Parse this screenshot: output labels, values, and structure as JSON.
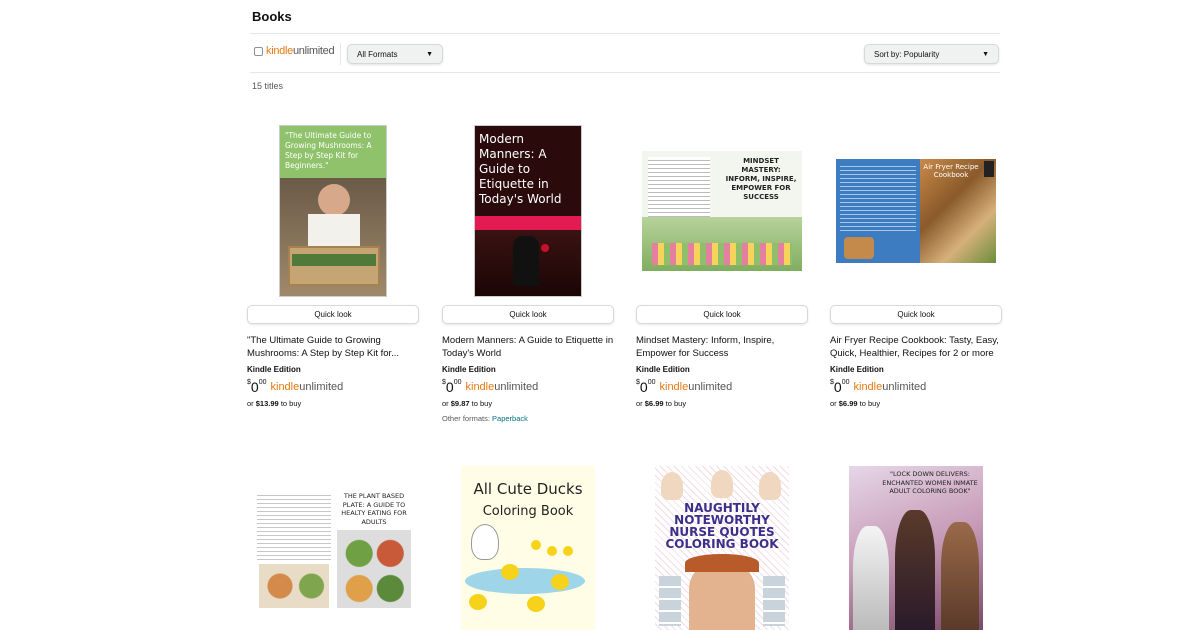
{
  "header": {
    "title": "Books"
  },
  "filters": {
    "ku_kindle": "kindle",
    "ku_unlimited": "unlimited",
    "formats_label": "All Formats",
    "sort_label": "Sort by: Popularity"
  },
  "results": {
    "count_label": "15 titles"
  },
  "common": {
    "quick_look": "Quick look",
    "edition": "Kindle Edition",
    "price_symbol": "$",
    "price_whole": "0",
    "price_fraction": "00",
    "ku_kindle": "kindle",
    "ku_unlimited": "unlimited",
    "to_buy": "to buy",
    "or": "or"
  },
  "books": [
    {
      "title": "\"The Ultimate Guide to Growing Mushrooms: A Step by Step Kit for...",
      "buy_price": "$13.99",
      "cover_text": "\"The Ultimate Guide to Growing Mushrooms: A Step by Step Kit for Beginners.\""
    },
    {
      "title": "Modern Manners: A Guide to Etiquette in Today's World",
      "buy_price": "$9.87",
      "cover_text": "Modern Manners: A Guide to Etiquette in Today's World",
      "other_formats_label": "Other formats:",
      "other_formats_link": "Paperback"
    },
    {
      "title": "Mindset Mastery: Inform, Inspire, Empower for Success",
      "buy_price": "$6.99",
      "cover_text": "MINDSET MASTERY: INFORM, INSPIRE, EMPOWER FOR SUCCESS"
    },
    {
      "title": "Air Fryer Recipe Cookbook: Tasty, Easy, Quick, Healthier, Recipes for 2 or more",
      "buy_price": "$6.99",
      "cover_text": "Air Fryer Recipe Cookbook"
    },
    {
      "cover_text": "THE PLANT BASED PLATE: A GUIDE TO HEALTY EATING FOR ADULTS"
    },
    {
      "cover_text": "All Cute Ducks",
      "cover_sub": "Coloring Book"
    },
    {
      "cover_text": "NAUGHTILY NOTEWORTHY NURSE QUOTES COLORING BOOK"
    },
    {
      "cover_text": "\"LOCK DOWN DELIVERS: ENCHANTED WOMEN INMATE ADULT COLORING BOOK\""
    }
  ],
  "colors": {
    "link": "#007185",
    "ku_orange": "#e47911",
    "border": "#d5d9d9"
  }
}
